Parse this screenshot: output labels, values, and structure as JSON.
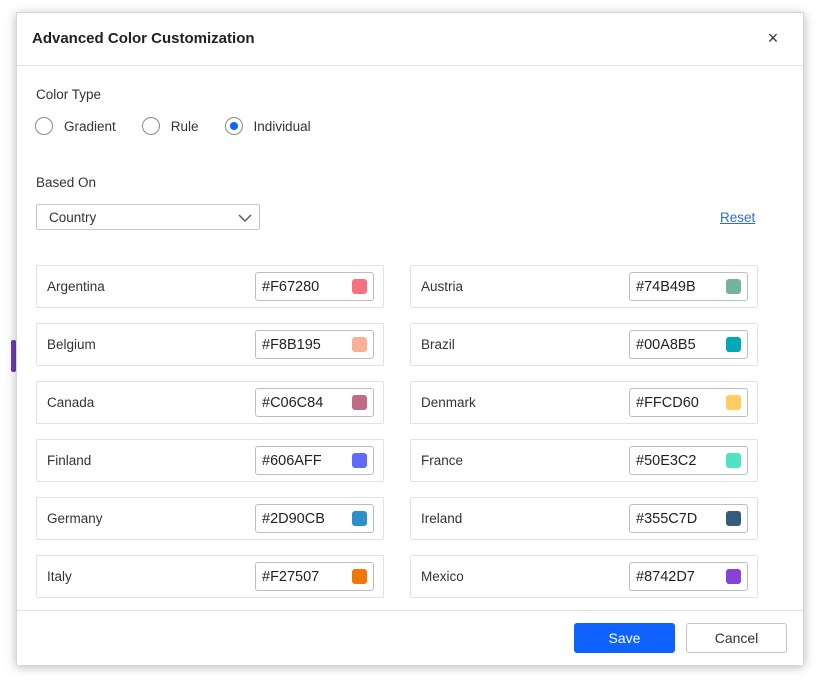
{
  "dialog": {
    "title": "Advanced Color Customization",
    "close_label": "×"
  },
  "color_type": {
    "label": "Color Type",
    "options": [
      {
        "label": "Gradient",
        "selected": false
      },
      {
        "label": "Rule",
        "selected": false
      },
      {
        "label": "Individual",
        "selected": true
      }
    ]
  },
  "based_on": {
    "label": "Based On",
    "selected": "Country"
  },
  "reset_label": "Reset",
  "colors": [
    {
      "name": "Argentina",
      "hex": "#F67280"
    },
    {
      "name": "Austria",
      "hex": "#74B49B"
    },
    {
      "name": "Belgium",
      "hex": "#F8B195"
    },
    {
      "name": "Brazil",
      "hex": "#00A8B5"
    },
    {
      "name": "Canada",
      "hex": "#C06C84"
    },
    {
      "name": "Denmark",
      "hex": "#FFCD60"
    },
    {
      "name": "Finland",
      "hex": "#606AFF"
    },
    {
      "name": "France",
      "hex": "#50E3C2"
    },
    {
      "name": "Germany",
      "hex": "#2D90CB"
    },
    {
      "name": "Ireland",
      "hex": "#355C7D"
    },
    {
      "name": "Italy",
      "hex": "#F27507"
    },
    {
      "name": "Mexico",
      "hex": "#8742D7"
    }
  ],
  "footer": {
    "save_label": "Save",
    "cancel_label": "Cancel"
  },
  "theme": {
    "accent": "#0f62fe",
    "link": "#2b6dd6"
  }
}
